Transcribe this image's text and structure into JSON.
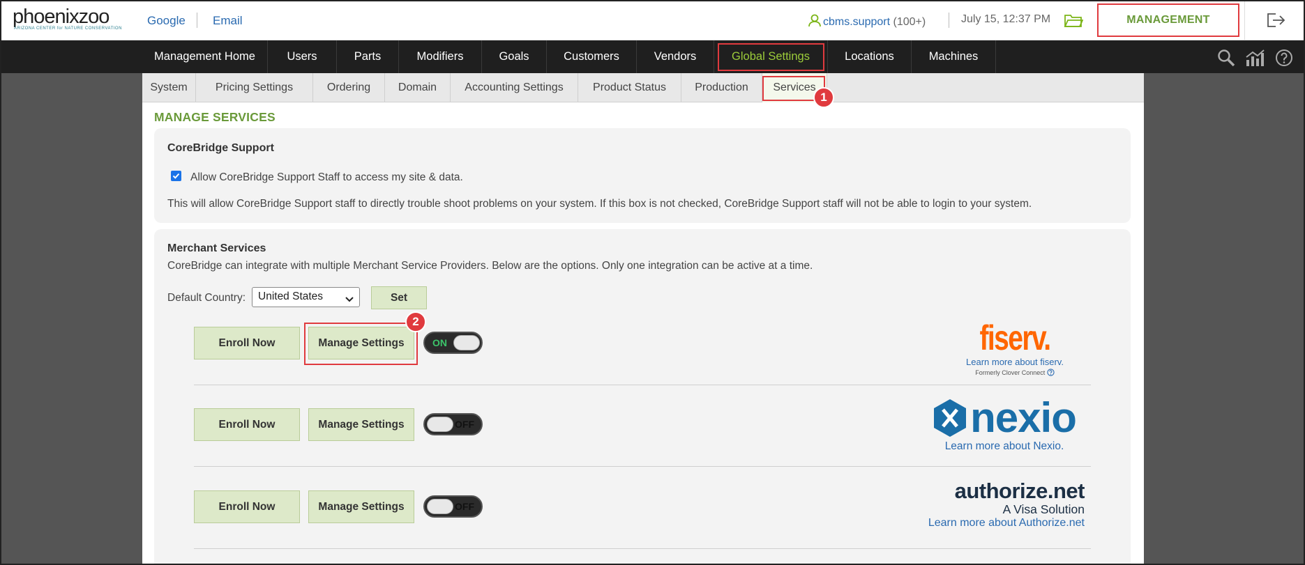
{
  "brand": {
    "logo": "phoenixzoo",
    "logo_sub": "ARIZONA CENTER for NATURE CONSERVATION"
  },
  "header": {
    "links": [
      "Google",
      "Email"
    ],
    "user": "cbms.support",
    "user_count": "(100+)",
    "datetime": "July 15, 12:37 PM",
    "management_label": "MANAGEMENT"
  },
  "nav": {
    "items": [
      "Management Home",
      "Users",
      "Parts",
      "Modifiers",
      "Goals",
      "Customers",
      "Vendors",
      "Global Settings",
      "Locations",
      "Machines"
    ],
    "active": "Global Settings"
  },
  "subtabs": {
    "items": [
      "System",
      "Pricing Settings",
      "Ordering",
      "Domain",
      "Accounting Settings",
      "Product Status",
      "Production",
      "Services"
    ],
    "active": "Services"
  },
  "annotations": {
    "step1": "1",
    "step2": "2"
  },
  "page": {
    "title": "MANAGE SERVICES",
    "support": {
      "title": "CoreBridge Support",
      "checkbox_label": "Allow CoreBridge Support Staff to access my site & data.",
      "checked": true,
      "description": "This will allow CoreBridge Support staff to directly trouble shoot problems on your system. If this box is not checked, CoreBridge Support staff will not be able to login to your system."
    },
    "merchant": {
      "title": "Merchant Services",
      "description": "CoreBridge can integrate with multiple Merchant Service Providers. Below are the options. Only one integration can be active at a time.",
      "country_label": "Default Country:",
      "country_value": "United States",
      "set_label": "Set",
      "enroll_label": "Enroll Now",
      "manage_label": "Manage Settings",
      "providers": [
        {
          "name": "fiserv.",
          "learn": "Learn more about fiserv.",
          "note": "Formerly Clover Connect",
          "toggle": "ON"
        },
        {
          "name": "nexio",
          "learn": "Learn more about Nexio.",
          "toggle": "OFF"
        },
        {
          "name": "authorize.net",
          "tagline": "A Visa Solution",
          "learn": "Learn more about Authorize.net",
          "toggle": "OFF"
        }
      ]
    }
  },
  "colors": {
    "accent_green": "#6a9a3a",
    "nav_active": "#9ccc3a",
    "highlight_red": "#e03a3e",
    "link_blue": "#2a6ab0",
    "fiserv_orange": "#ff6600",
    "nexio_blue": "#1a6ea8"
  },
  "icons": [
    "user-icon",
    "folder-icon",
    "logout-icon",
    "search-icon",
    "analytics-icon",
    "help-icon",
    "checkbox-checked-icon",
    "chevron-down-icon",
    "question-circle-icon"
  ]
}
